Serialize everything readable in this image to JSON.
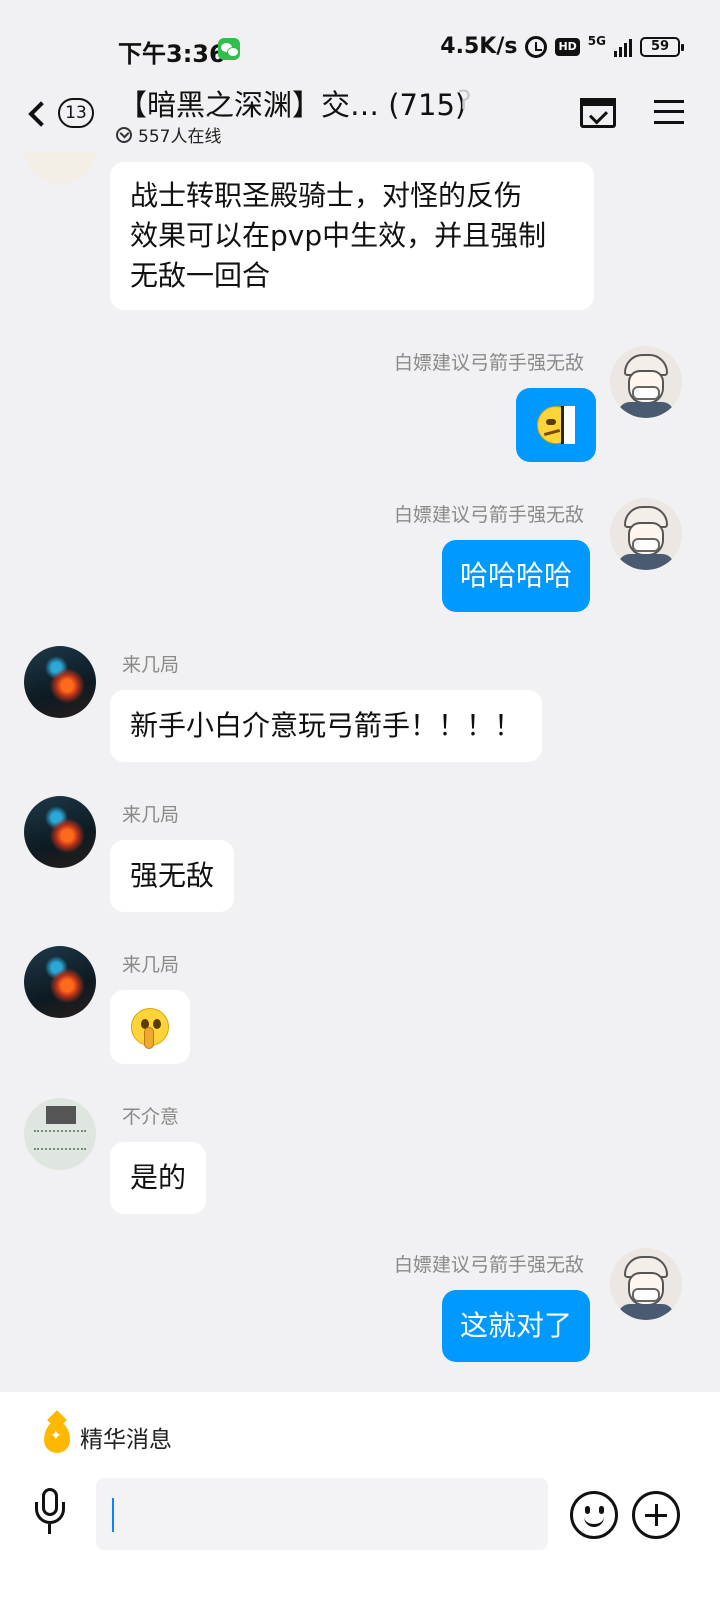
{
  "status_bar": {
    "time": "下午3:36",
    "net_speed": "4.5K/s",
    "hd_badge": "HD",
    "network": "5G",
    "battery": "59",
    "icons": [
      "wechat-icon",
      "alarm-icon",
      "signal-icon",
      "battery-icon"
    ]
  },
  "header": {
    "unread_count": "13",
    "title": "【暗黑之深渊】交…",
    "member_count": "(715)",
    "online_text": "557人在线",
    "icons": [
      "back-icon",
      "ear-icon",
      "calendar-check-icon",
      "menu-icon"
    ]
  },
  "messages": [
    {
      "sender": "",
      "text": "战士转职圣殿骑士，对怪的反伤\n效果可以在pvp中生效，并且强制\n无敌一回合",
      "mine": false
    },
    {
      "sender": "白嫖建议弓箭手强无敌",
      "text": "",
      "emoji": "smirk-emoji",
      "mine": true
    },
    {
      "sender": "白嫖建议弓箭手强无敌",
      "text": "哈哈哈哈",
      "mine": true
    },
    {
      "sender": "来几局",
      "text": "新手小白介意玩弓箭手！！！！",
      "mine": false
    },
    {
      "sender": "来几局",
      "text": "强无敌",
      "mine": false
    },
    {
      "sender": "来几局",
      "text": "",
      "emoji": "shush-emoji",
      "mine": false
    },
    {
      "sender": "不介意",
      "text": "是的",
      "mine": false
    },
    {
      "sender": "白嫖建议弓箭手强无敌",
      "text": "这就对了",
      "mine": true
    }
  ],
  "bottom": {
    "essence_label": "精华消息",
    "input_value": "",
    "icons": [
      "essence-drop-icon",
      "microphone-icon",
      "emoji-icon",
      "plus-icon"
    ]
  },
  "colors": {
    "my_bubble": "#0099ff",
    "other_bubble": "#ffffff",
    "background": "#f1f1f3",
    "sender_name": "#8a8a8a"
  }
}
